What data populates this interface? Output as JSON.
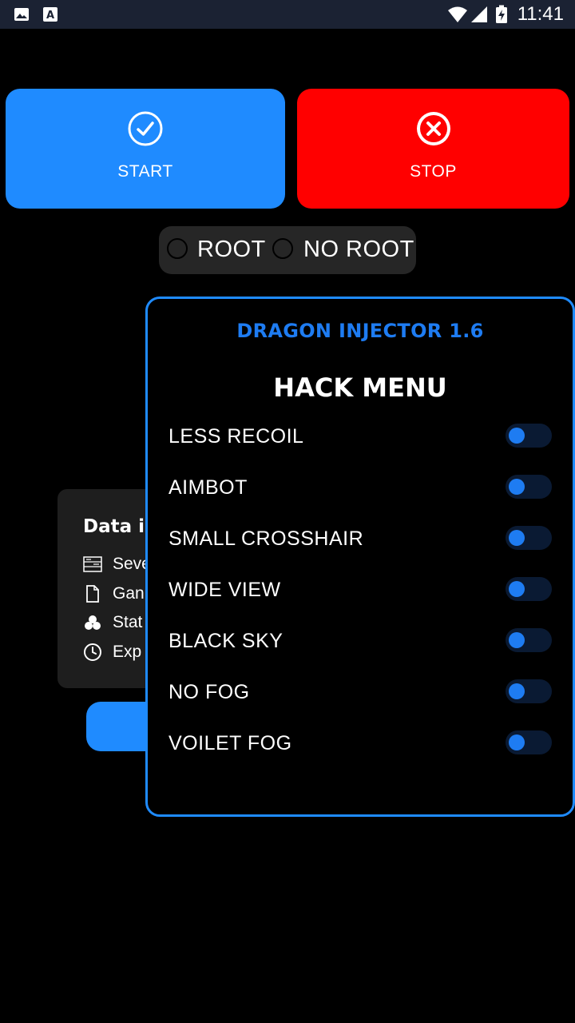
{
  "status_bar": {
    "time": "11:41",
    "icons": [
      "image-icon",
      "font-icon",
      "wifi-icon",
      "signal-icon",
      "battery-charging-icon"
    ]
  },
  "controls": {
    "start_label": "START",
    "stop_label": "STOP",
    "start_color": "#1f8bff",
    "stop_color": "#ff0000"
  },
  "mode": {
    "root_label": "ROOT",
    "noroot_label": "NO ROOT"
  },
  "info_card": {
    "title": "Data i",
    "rows": [
      {
        "icon": "server-icon",
        "text": "Seve"
      },
      {
        "icon": "file-icon",
        "text": "Gan"
      },
      {
        "icon": "status-icon",
        "text": "Stat"
      },
      {
        "icon": "clock-icon",
        "text": "Exp"
      }
    ]
  },
  "menu": {
    "title": "DRAGON INJECTOR 1.6",
    "subtitle": "HACK MENU",
    "accent": "#1e7cf2",
    "items": [
      {
        "label": "LESS RECOIL",
        "on": false
      },
      {
        "label": "AIMBOT",
        "on": false
      },
      {
        "label": "SMALL CROSSHAIR",
        "on": false
      },
      {
        "label": "WIDE VIEW",
        "on": false
      },
      {
        "label": "BLACK SKY",
        "on": false
      },
      {
        "label": "NO FOG",
        "on": false
      },
      {
        "label": "VOILET FOG",
        "on": false
      }
    ]
  }
}
